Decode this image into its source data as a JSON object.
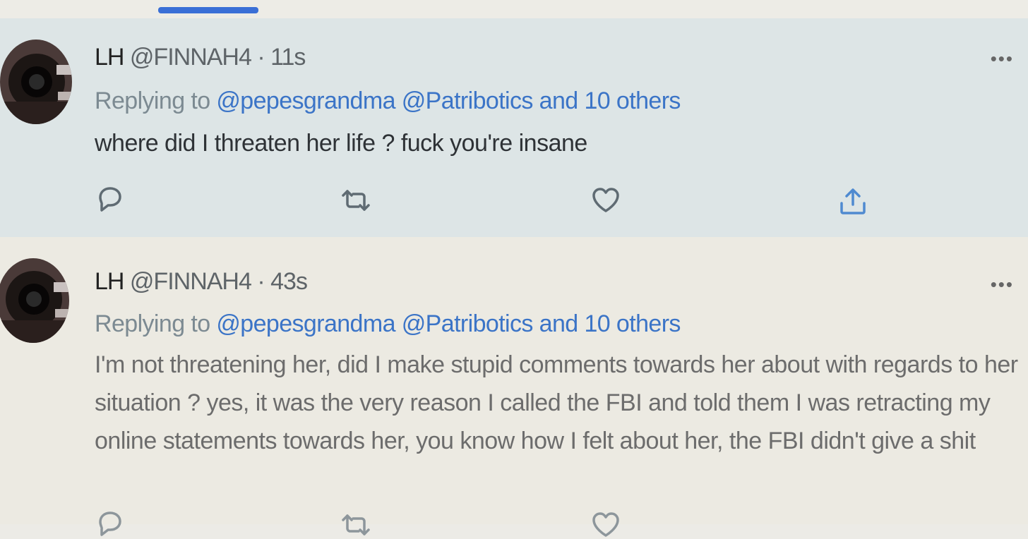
{
  "app": {
    "accent_color": "#3a6fd6",
    "link_color": "#3b74c7"
  },
  "tweets": [
    {
      "name": "LH",
      "handle": "@FINNAH4",
      "separator": "·",
      "time": "11s",
      "replying_prefix": "Replying to",
      "mention_1": "@pepesgrandma",
      "mention_2": "@Patribotics",
      "mention_and": "and",
      "mention_others": "10 others",
      "text": "where did I threaten her life ? fuck you're insane",
      "more": "•••"
    },
    {
      "name": "LH",
      "handle": "@FINNAH4",
      "separator": "·",
      "time": "43s",
      "replying_prefix": "Replying to",
      "mention_1": "@pepesgrandma",
      "mention_2": "@Patribotics",
      "mention_and": "and",
      "mention_others": "10 others",
      "text": "I'm not threatening her, did I make stupid comments towards her about with regards to her situation ? yes, it was the very reason I called the FBI and told them I was retracting my online statements towards her, you know how I felt about her, the FBI didn't give a shit",
      "more": "•••"
    }
  ],
  "icons": [
    "reply-icon",
    "retweet-icon",
    "like-icon",
    "share-icon"
  ]
}
